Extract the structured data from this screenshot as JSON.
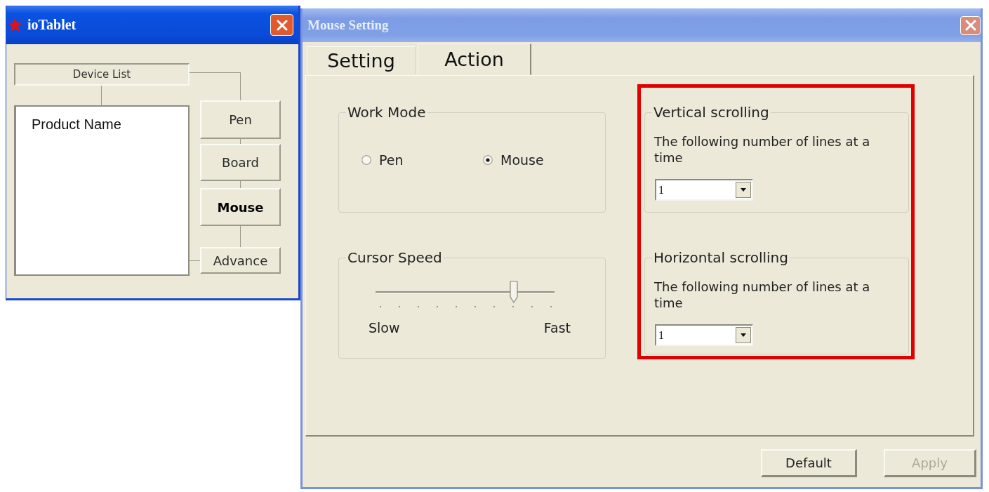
{
  "device_window": {
    "title": "ioTablet",
    "active": true,
    "list_header": "Device List",
    "list_items": [
      {
        "label": "Product Name",
        "selected": false
      }
    ],
    "nav_buttons": [
      {
        "label": "Pen",
        "selected": false
      },
      {
        "label": "Board",
        "selected": false
      },
      {
        "label": "Mouse",
        "selected": true
      },
      {
        "label": "Advance",
        "selected": false
      }
    ]
  },
  "settings_window": {
    "title": "Mouse Setting",
    "active": false,
    "tabs": [
      {
        "label": "Setting",
        "selected": false
      },
      {
        "label": "Action",
        "selected": true
      }
    ],
    "work_mode": {
      "title": "Work Mode",
      "options": [
        {
          "label": "Pen",
          "selected": false
        },
        {
          "label": "Mouse",
          "selected": true
        }
      ]
    },
    "cursor_speed": {
      "title": "Cursor Speed",
      "level": 0.78,
      "min_label": "Slow",
      "max_label": "Fast"
    },
    "scrolling_highlighted": true,
    "scrolling": [
      {
        "title": "Vertical scrolling",
        "description": "The following number of lines at a time",
        "value": "1"
      },
      {
        "title": "Horizontal scrolling",
        "description": "The following number of lines at a time",
        "value": "1"
      }
    ],
    "buttons": [
      {
        "label": "Default",
        "disabled": false
      },
      {
        "label": "Apply",
        "disabled": true
      }
    ]
  }
}
